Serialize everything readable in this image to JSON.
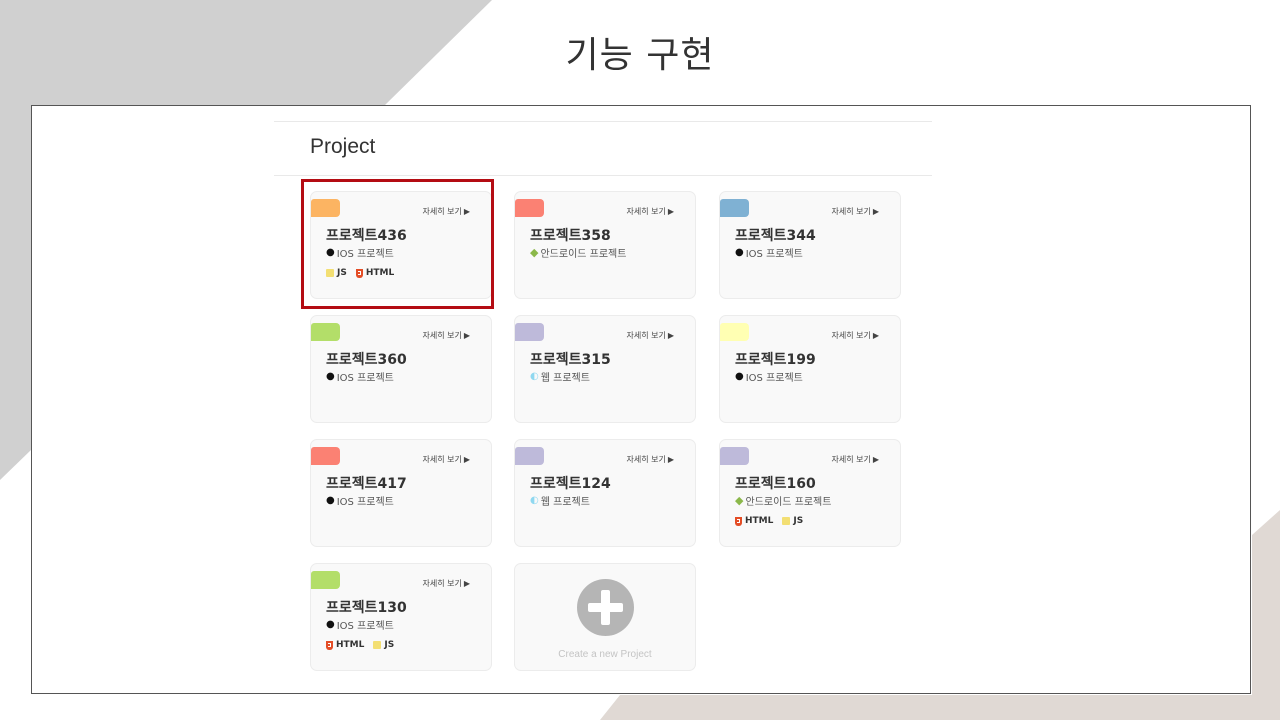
{
  "slide": {
    "title": "기능 구현"
  },
  "section": {
    "title": "Project"
  },
  "colors": {
    "orange": "#fcb462",
    "salmon": "#fb8173",
    "blue": "#7fb1d3",
    "green": "#b3de69",
    "lavender": "#bebada",
    "yellow": "#ffffb3",
    "selection": "#b40c13"
  },
  "detail_label": "자세히 보기",
  "detail_arrow": "▶",
  "projects": [
    {
      "name": "프로젝트436",
      "platform": "IOS 프로젝트",
      "platform_icon": "apple-icon",
      "tag_color": "#fcb462",
      "techs": [
        "JS",
        "HTML"
      ],
      "selected": true
    },
    {
      "name": "프로젝트358",
      "platform": "안드로이드 프로젝트",
      "platform_icon": "android-icon",
      "tag_color": "#fb8173",
      "techs": []
    },
    {
      "name": "프로젝트344",
      "platform": "IOS 프로젝트",
      "platform_icon": "apple-icon",
      "tag_color": "#7fb1d3",
      "techs": []
    },
    {
      "name": "프로젝트360",
      "platform": "IOS 프로젝트",
      "platform_icon": "apple-icon",
      "tag_color": "#b3de69",
      "techs": []
    },
    {
      "name": "프로젝트315",
      "platform": "웹 프로젝트",
      "platform_icon": "web-icon",
      "tag_color": "#bebada",
      "techs": []
    },
    {
      "name": "프로젝트199",
      "platform": "IOS 프로젝트",
      "platform_icon": "apple-icon",
      "tag_color": "#ffffb3",
      "techs": []
    },
    {
      "name": "프로젝트417",
      "platform": "IOS 프로젝트",
      "platform_icon": "apple-icon",
      "tag_color": "#fb8173",
      "techs": []
    },
    {
      "name": "프로젝트124",
      "platform": "웹 프로젝트",
      "platform_icon": "web-icon",
      "tag_color": "#bebada",
      "techs": []
    },
    {
      "name": "프로젝트160",
      "platform": "안드로이드 프로젝트",
      "platform_icon": "android-icon",
      "tag_color": "#bebada",
      "techs": [
        "HTML",
        "JS"
      ]
    },
    {
      "name": "프로젝트130",
      "platform": "IOS 프로젝트",
      "platform_icon": "apple-icon",
      "tag_color": "#b3de69",
      "techs": [
        "HTML",
        "JS"
      ]
    }
  ],
  "create": {
    "label": "Create a new Project",
    "icon": "plus-icon"
  }
}
